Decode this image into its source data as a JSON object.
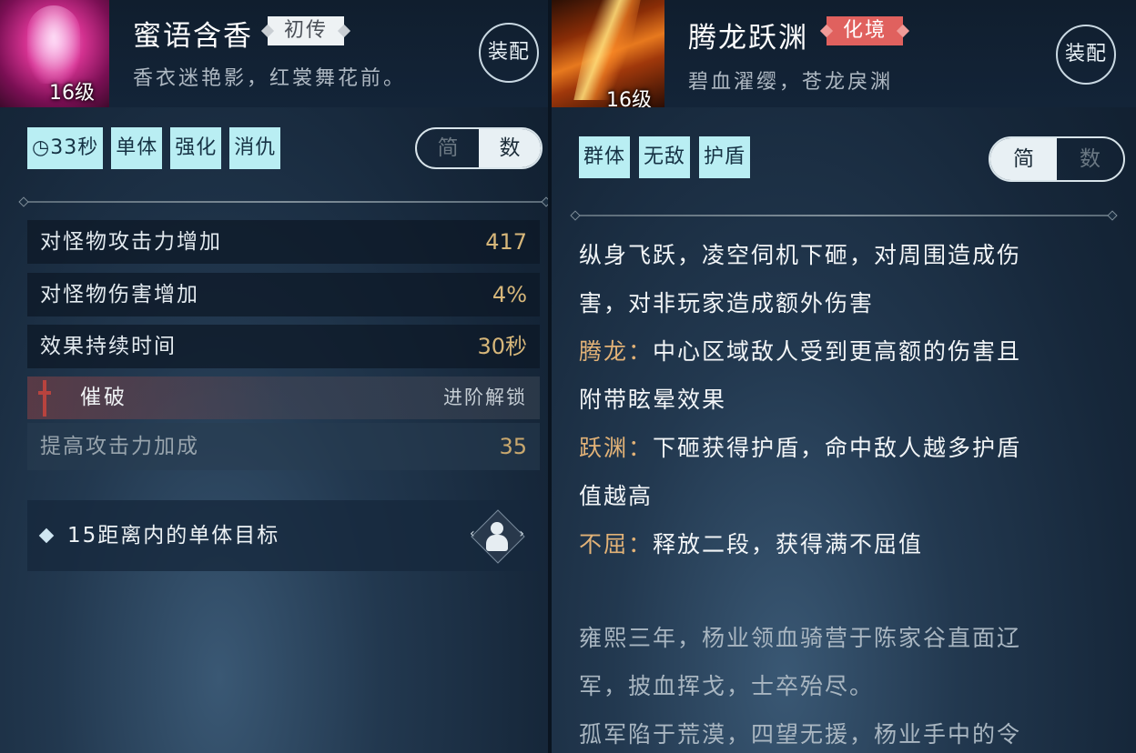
{
  "left_panel": {
    "skill": {
      "name": "蜜语含香",
      "rank": "初传",
      "description": "香衣迷艳影，红裳舞花前。",
      "level": "16级",
      "equip_label": "装配"
    },
    "tags": [
      "33秒",
      "单体",
      "强化",
      "消仇"
    ],
    "view_toggle": {
      "simple": "简",
      "numeric": "数",
      "active": "numeric"
    },
    "stats": [
      {
        "label": "对怪物攻击力增加",
        "value": "417"
      },
      {
        "label": "对怪物伤害增加",
        "value": "4%"
      },
      {
        "label": "效果持续时间",
        "value": "30秒"
      }
    ],
    "locked_upgrade": {
      "name": "催破",
      "status": "进阶解锁",
      "stat_label": "提高攻击力加成",
      "stat_value": "35"
    },
    "target": {
      "label": "15距离内的单体目标"
    }
  },
  "right_panel": {
    "skill": {
      "name": "腾龙跃渊",
      "rank": "化境",
      "description": "碧血濯缨，苍龙戾渊",
      "level": "16级",
      "equip_label": "装配"
    },
    "tags": [
      "群体",
      "无敌",
      "护盾"
    ],
    "view_toggle": {
      "simple": "简",
      "numeric": "数",
      "active": "simple"
    },
    "description_lines": [
      {
        "key": "",
        "text": "纵身飞跃，凌空伺机下砸，对周围造成伤"
      },
      {
        "key": "",
        "text": "害，对非玩家造成额外伤害"
      },
      {
        "key": "腾龙：",
        "text": "中心区域敌人受到更高额的伤害且"
      },
      {
        "key": "",
        "text": "附带眩晕效果"
      },
      {
        "key": "跃渊：",
        "text": "下砸获得护盾，命中敌人越多护盾"
      },
      {
        "key": "",
        "text": "值越高"
      },
      {
        "key": "不屈：",
        "text": "释放二段，获得满不屈值"
      }
    ],
    "lore_lines": [
      "雍熙三年，杨业领血骑营于陈家谷直面辽",
      "军，披血挥戈，士卒殆尽。",
      "孤军陷于荒漠，四望无援，杨业手中的令"
    ]
  },
  "colors": {
    "tag_bg": "#b9eef3",
    "value_gold": "#d7b77a",
    "key_orange": "#e2b277",
    "rank_red": "#e0615e",
    "rank_white": "#eef2f4"
  }
}
